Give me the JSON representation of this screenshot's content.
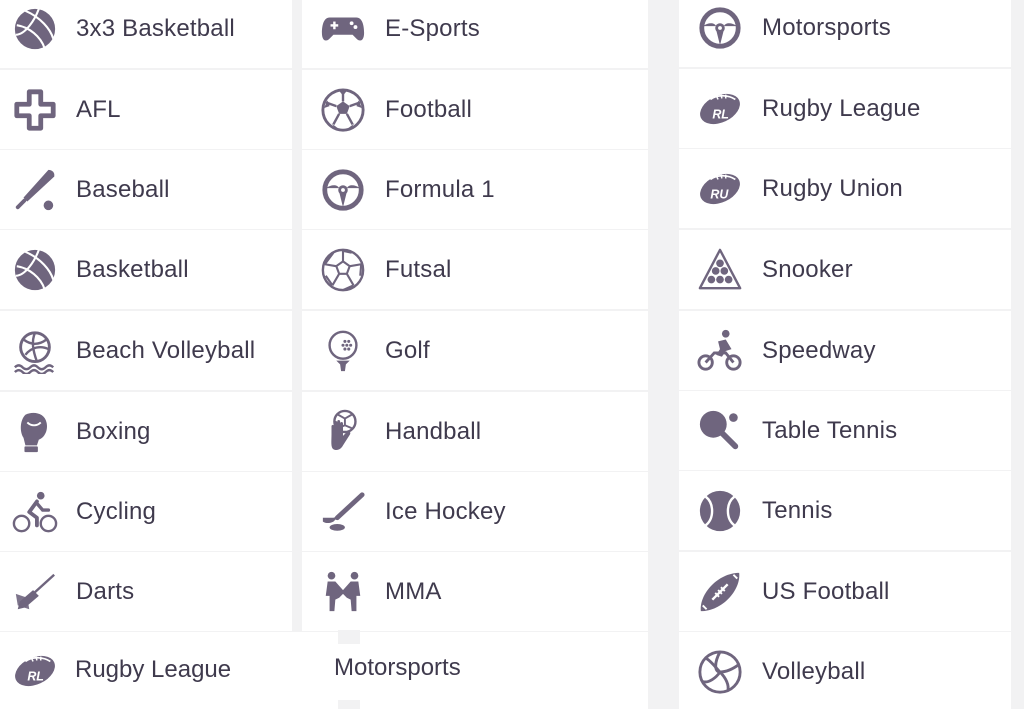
{
  "colors": {
    "icon": "#6f657e",
    "text": "#3f3a4d",
    "row_bg": "#ffffff",
    "divider": "#f2f2f3"
  },
  "columns": [
    {
      "items": [
        {
          "label": "3x3 Basketball",
          "icon": "basketball-icon"
        },
        {
          "label": "AFL",
          "icon": "afl-cross-icon"
        },
        {
          "label": "Baseball",
          "icon": "baseball-bat-icon"
        },
        {
          "label": "Basketball",
          "icon": "basketball-icon"
        },
        {
          "label": "Beach Volleyball",
          "icon": "beach-volleyball-icon"
        },
        {
          "label": "Boxing",
          "icon": "boxing-glove-icon"
        },
        {
          "label": "Cycling",
          "icon": "cyclist-icon"
        },
        {
          "label": "Darts",
          "icon": "dart-icon"
        }
      ]
    },
    {
      "items": [
        {
          "label": "E-Sports",
          "icon": "gamepad-icon"
        },
        {
          "label": "Football",
          "icon": "soccer-ball-icon"
        },
        {
          "label": "Formula 1",
          "icon": "steering-wheel-icon"
        },
        {
          "label": "Futsal",
          "icon": "futsal-ball-icon"
        },
        {
          "label": "Golf",
          "icon": "golf-ball-tee-icon"
        },
        {
          "label": "Handball",
          "icon": "handball-icon"
        },
        {
          "label": "Ice Hockey",
          "icon": "hockey-stick-icon"
        },
        {
          "label": "MMA",
          "icon": "mma-fighters-icon"
        }
      ]
    },
    {
      "items": [
        {
          "label": "Motorsports",
          "icon": "steering-wheel-icon"
        },
        {
          "label": "Rugby League",
          "icon": "rugby-league-ball-icon"
        },
        {
          "label": "Rugby Union",
          "icon": "rugby-union-ball-icon"
        },
        {
          "label": "Snooker",
          "icon": "snooker-triangle-icon"
        },
        {
          "label": "Speedway",
          "icon": "speedway-rider-icon"
        },
        {
          "label": "Table Tennis",
          "icon": "table-tennis-paddle-icon"
        },
        {
          "label": "Tennis",
          "icon": "tennis-ball-icon"
        },
        {
          "label": "US Football",
          "icon": "us-football-icon"
        },
        {
          "label": "Volleyball",
          "icon": "volleyball-icon"
        }
      ]
    }
  ],
  "overflow_row": {
    "left": {
      "label": "Rugby League",
      "icon": "rugby-league-ball-icon"
    },
    "middle": {
      "label": "Motorsports"
    }
  }
}
